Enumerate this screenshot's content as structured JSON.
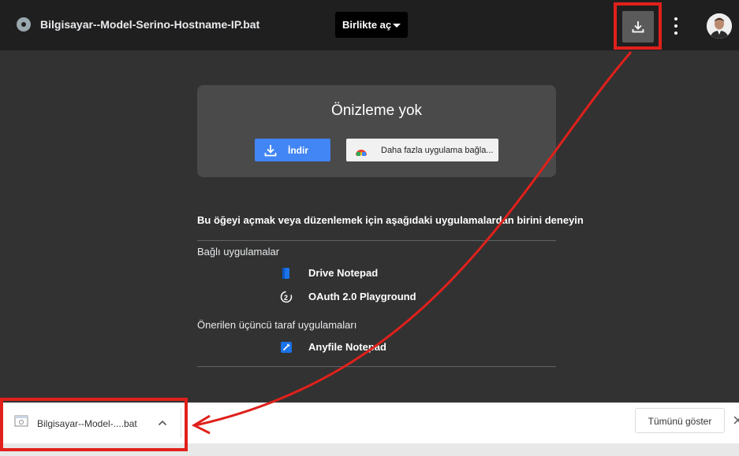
{
  "topbar": {
    "file_name": "Bilgisayar--Model-Serino-Hostname-IP.bat",
    "open_with_label": "Birlikte aç",
    "icons": [
      "file-type-icon",
      "download-icon",
      "more-vert-icon",
      "user-avatar"
    ]
  },
  "preview": {
    "title": "Önizleme yok",
    "download_label": "İndir",
    "more_apps_label": "Daha fazla uygulama bağla..."
  },
  "apps": {
    "heading": "Bu öğeyi açmak veya düzenlemek için aşağıdaki uygulamalardan birini deneyin",
    "connected_label": "Bağlı uygulamalar",
    "connected": [
      {
        "name": "Drive Notepad",
        "icon": "drive-notepad-icon"
      },
      {
        "name": "OAuth 2.0 Playground",
        "icon": "oauth-playground-icon"
      }
    ],
    "suggested_label": "Önerilen üçüncü taraf uygulamaları",
    "suggested": [
      {
        "name": "Anyfile Notepad",
        "icon": "anyfile-notepad-icon"
      }
    ]
  },
  "download_shelf": {
    "file_name": "Bilgisayar--Model-....bat",
    "show_all_label": "Tümünü göster"
  },
  "colors": {
    "viewer_bg": "#323232",
    "topbar_bg": "#1f1f1f",
    "card_bg": "#4a4a4a",
    "primary_button": "#4285f4",
    "annotation_red": "#e0201b"
  }
}
